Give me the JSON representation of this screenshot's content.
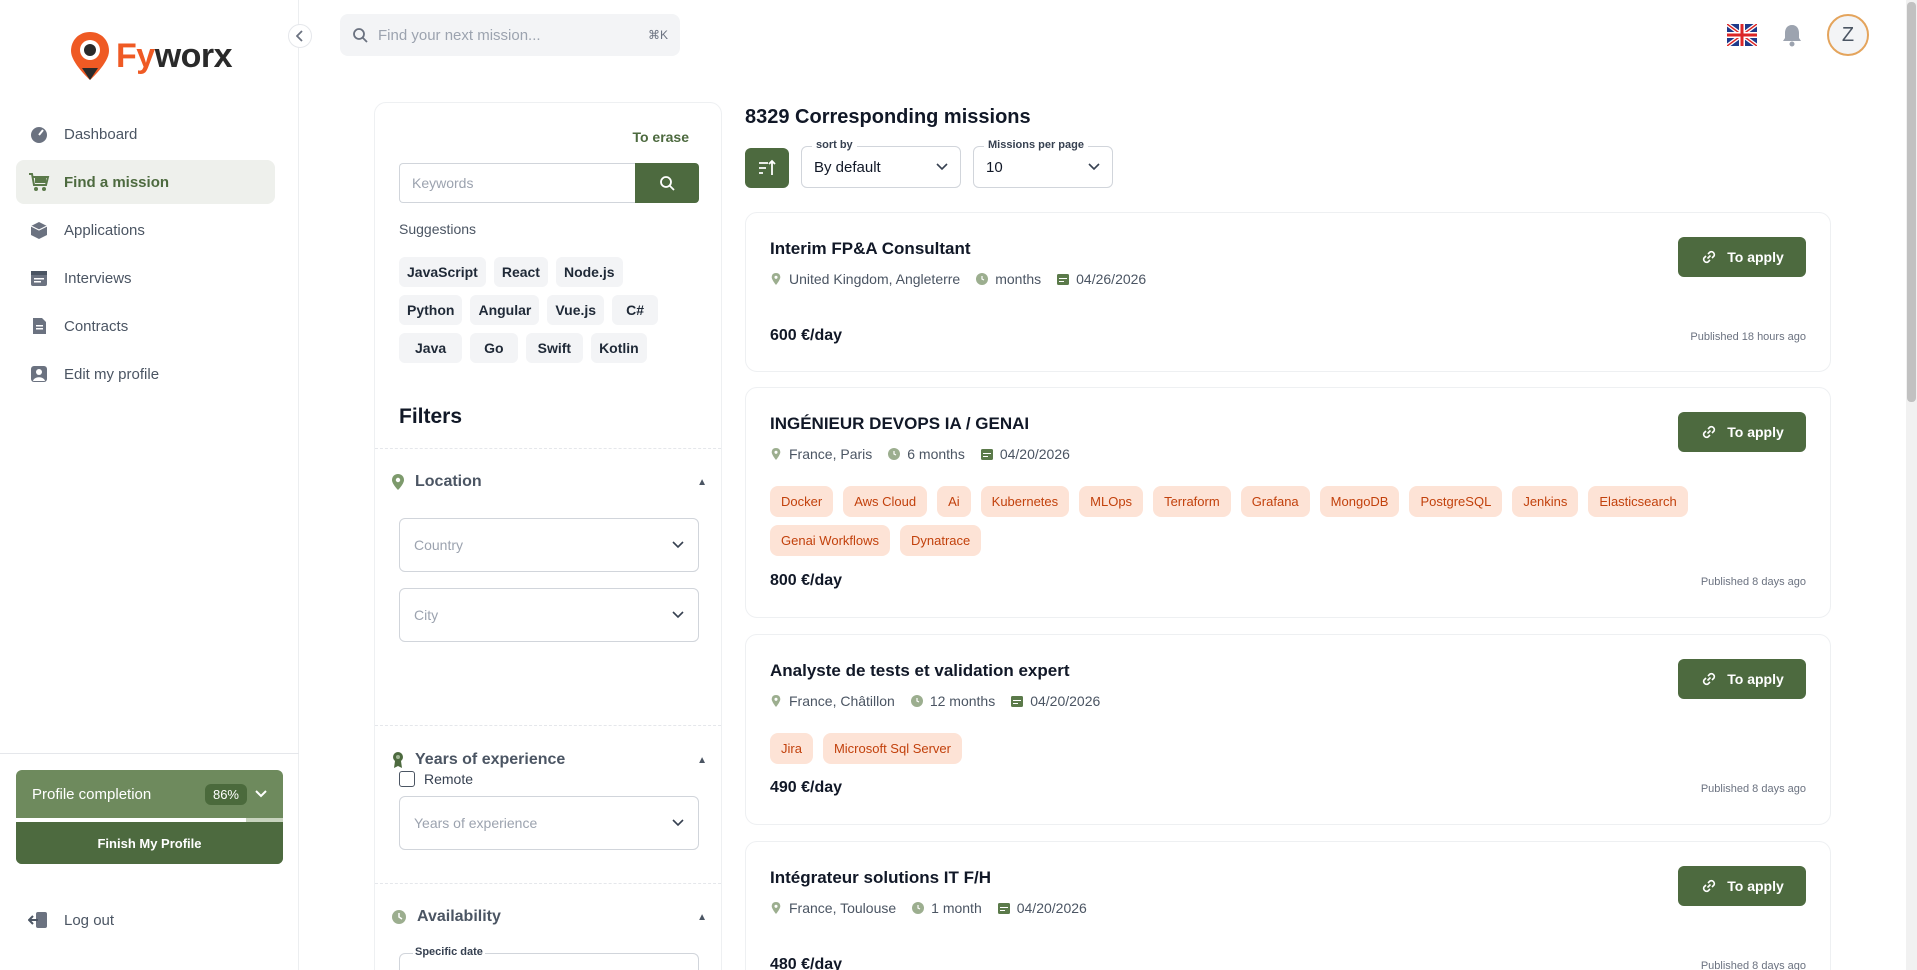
{
  "brand": {
    "name_part1": "Fy",
    "name_part2": "worx",
    "accent": "#ef5a24",
    "primary": "#4d6a3f"
  },
  "topbar": {
    "search_placeholder": "Find your next mission...",
    "search_shortcut": "⌘K",
    "language_icon": "uk-flag-icon",
    "notification_icon": "bell-icon",
    "avatar_initial": "Z"
  },
  "sidebar": {
    "items": [
      {
        "label": "Dashboard",
        "icon": "gauge-icon",
        "active": false
      },
      {
        "label": "Find a mission",
        "icon": "cart-icon",
        "active": true
      },
      {
        "label": "Applications",
        "icon": "box-icon",
        "active": false
      },
      {
        "label": "Interviews",
        "icon": "calendar-icon",
        "active": false
      },
      {
        "label": "Contracts",
        "icon": "document-icon",
        "active": false
      },
      {
        "label": "Edit my profile",
        "icon": "user-icon",
        "active": false
      }
    ],
    "profile_completion": {
      "label": "Profile completion",
      "percent_text": "86%",
      "percent": 86,
      "button": "Finish My Profile"
    },
    "logout": "Log out"
  },
  "filters": {
    "erase": "To erase",
    "keywords_placeholder": "Keywords",
    "suggestions_label": "Suggestions",
    "suggestions": [
      [
        "JavaScript",
        "React",
        "Node.js"
      ],
      [
        "Python",
        "Angular",
        "Vue.js",
        "C#"
      ],
      [
        "Java",
        "Go",
        "Swift",
        "Kotlin"
      ]
    ],
    "title": "Filters",
    "location": {
      "label": "Location",
      "country": "Country",
      "city": "City",
      "remote": "Remote"
    },
    "experience": {
      "label": "Years of experience",
      "placeholder": "Years of experience"
    },
    "availability": {
      "label": "Availability",
      "date_label": "Specific date"
    }
  },
  "results": {
    "title": "8329 Corresponding missions",
    "sort_label": "sort by",
    "sort_value": "By default",
    "per_page_label": "Missions per page",
    "per_page_value": "10",
    "apply_label": "To apply",
    "missions": [
      {
        "title": "Interim FP&A Consultant",
        "location": "United Kingdom, Angleterre",
        "duration": "months",
        "date": "04/26/2026",
        "tags": [],
        "price": "600 €/day",
        "published": "Published 18 hours ago"
      },
      {
        "title": "INGÉNIEUR DEVOPS IA / GENAI",
        "location": "France, Paris",
        "duration": "6 months",
        "date": "04/20/2026",
        "tags": [
          "Docker",
          "Aws Cloud",
          "Ai",
          "Kubernetes",
          "MLOps",
          "Terraform",
          "Grafana",
          "MongoDB",
          "PostgreSQL",
          "Jenkins",
          "Elasticsearch",
          "Genai Workflows",
          "Dynatrace"
        ],
        "price": "800 €/day",
        "published": "Published 8 days ago"
      },
      {
        "title": "Analyste de tests et validation expert",
        "location": "France, Châtillon",
        "duration": "12 months",
        "date": "04/20/2026",
        "tags": [
          "Jira",
          "Microsoft Sql Server"
        ],
        "price": "490 €/day",
        "published": "Published 8 days ago"
      },
      {
        "title": "Intégrateur solutions IT F/H",
        "location": "France, Toulouse",
        "duration": "1 month",
        "date": "04/20/2026",
        "tags": [],
        "price": "480 €/day",
        "published": "Published 8 days ago"
      }
    ]
  }
}
